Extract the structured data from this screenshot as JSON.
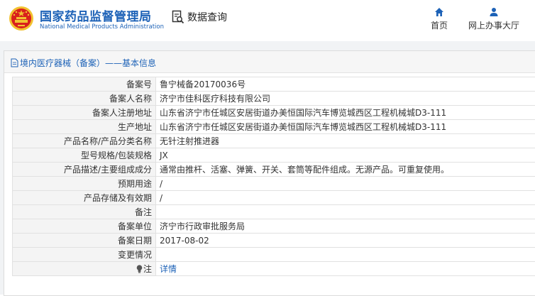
{
  "header": {
    "logo_cn": "国家药品监督管理局",
    "logo_en": "National Medical Products Administration",
    "data_query_label": "数据查询",
    "nav": [
      {
        "label": "首页",
        "icon": "home-icon"
      },
      {
        "label": "网上办事大厅",
        "icon": "person-icon"
      }
    ],
    "colors": {
      "brand": "#1d62b7",
      "emblem_red": "#d9201c",
      "emblem_gold": "#f2c230"
    }
  },
  "panel": {
    "title": "境内医疗器械（备案）——基本信息",
    "rows": [
      {
        "label": "备案号",
        "value": "鲁宁械备20170036号"
      },
      {
        "label": "备案人名称",
        "value": "济宁市佳科医疗科技有限公司"
      },
      {
        "label": "备案人注册地址",
        "value": "山东省济宁市任城区安居街道办美恒国际汽车博览城西区工程机械城D3-111"
      },
      {
        "label": "生产地址",
        "value": "山东省济宁市任城区安居街道办美恒国际汽车博览城西区工程机械城D3-111"
      },
      {
        "label": "产品名称/产品分类名称",
        "value": "无针注射推进器"
      },
      {
        "label": "型号规格/包装规格",
        "value": "JX"
      },
      {
        "label": "产品描述/主要组成成分",
        "value": "通常由推杆、活塞、弹簧、开关、套筒等配件组成。无源产品。可重复使用。"
      },
      {
        "label": "预期用途",
        "value": "/"
      },
      {
        "label": "产品存储及有效期",
        "value": "/"
      },
      {
        "label": "备注",
        "value": ""
      },
      {
        "label": "备案单位",
        "value": "济宁市行政审批服务局"
      },
      {
        "label": "备案日期",
        "value": "2017-08-02"
      },
      {
        "label": "变更情况",
        "value": ""
      },
      {
        "label": "注",
        "value": "详情"
      }
    ]
  }
}
